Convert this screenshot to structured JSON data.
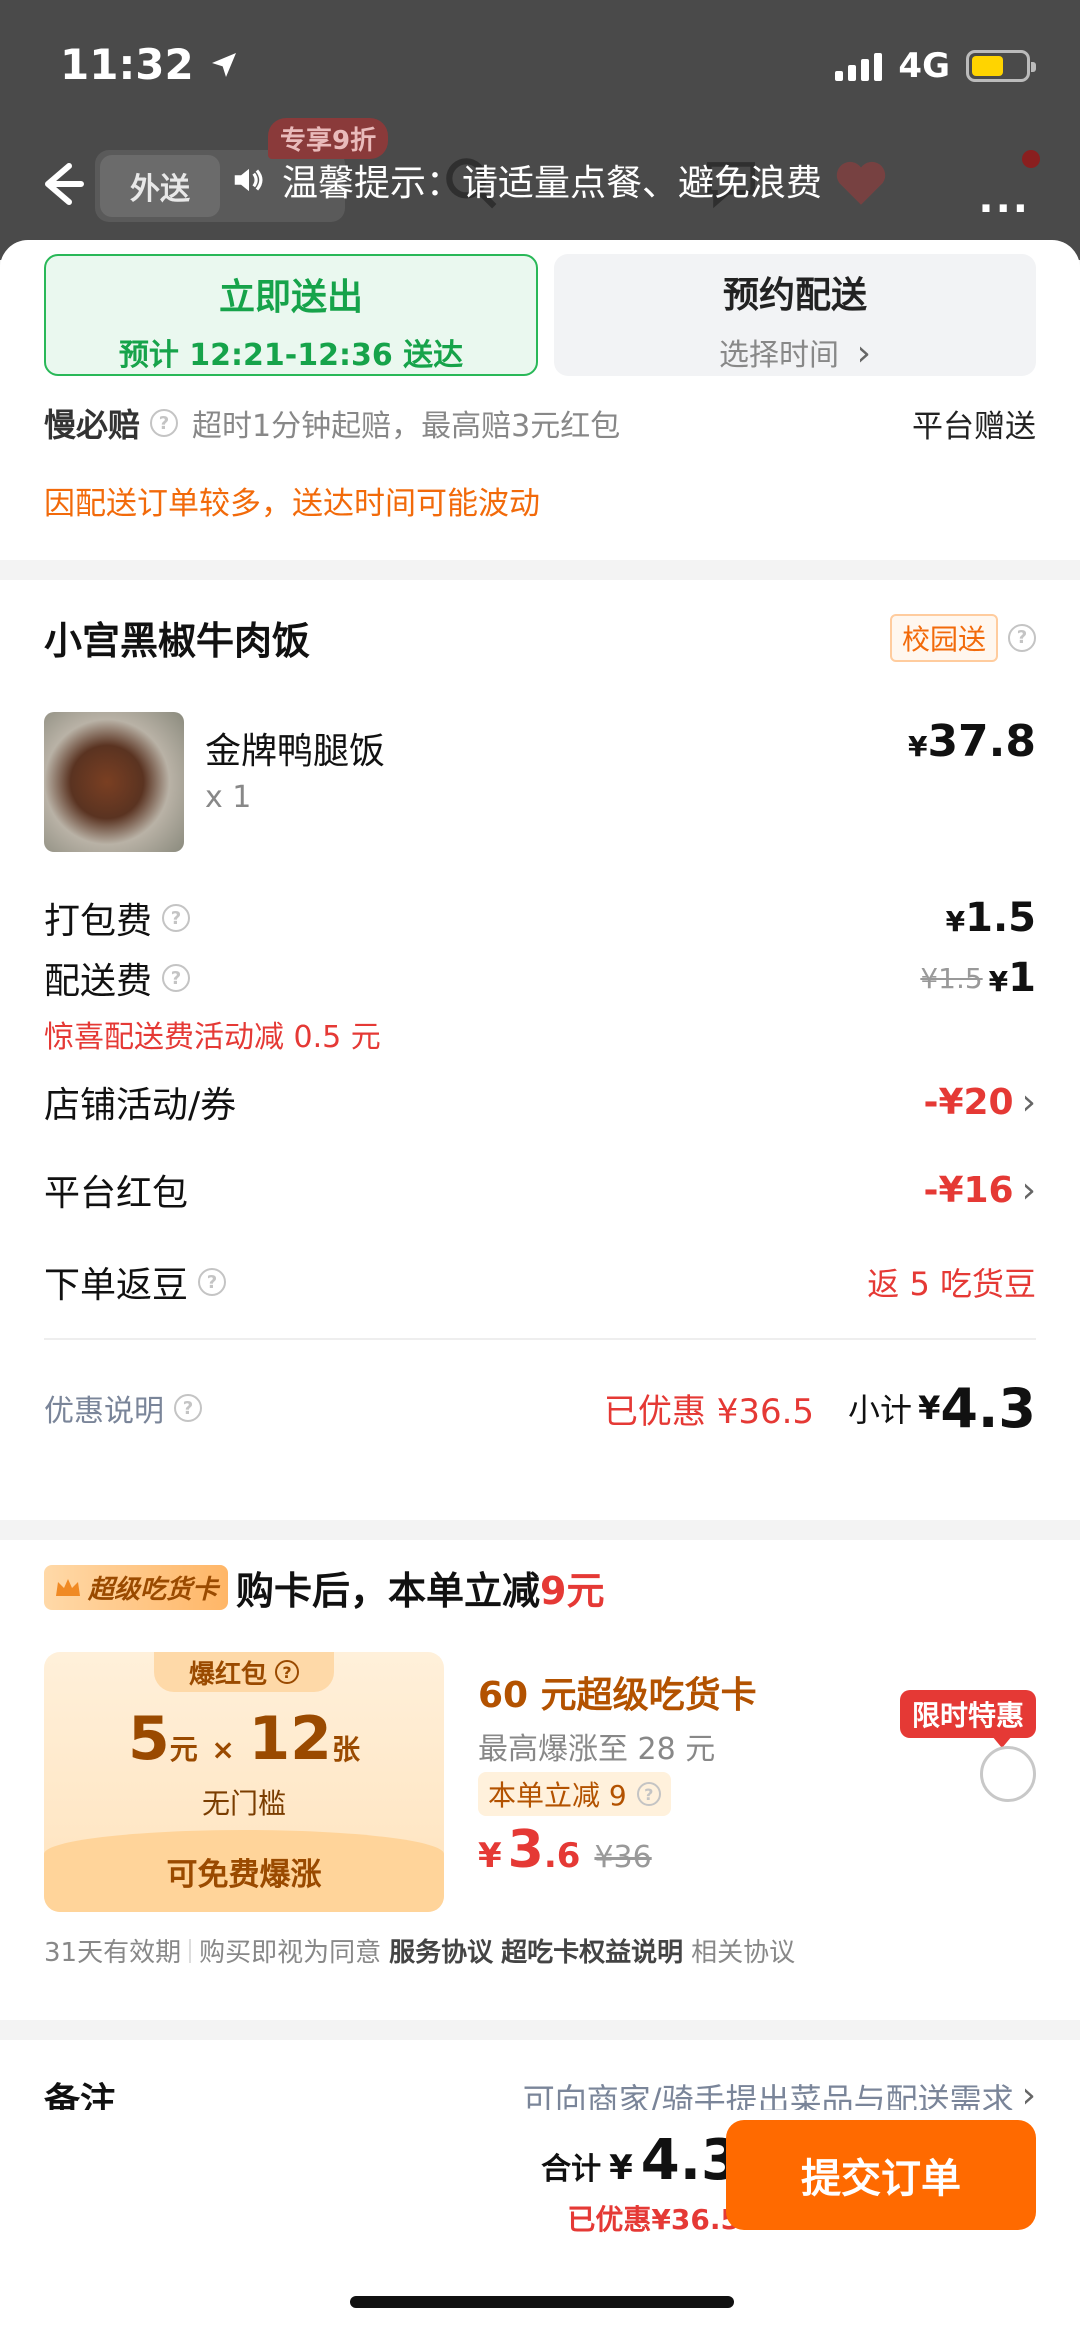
{
  "status_bar": {
    "time": "11:32",
    "network": "4G"
  },
  "nav": {
    "tab_active": "外送",
    "promo_tag": "专享9折",
    "notice": "温馨提示：请适量点餐、避免浪费",
    "more": "..."
  },
  "delivery": {
    "now_title": "立即送出",
    "now_eta": "预计 12:21-12:36 送达",
    "later_title": "预约配送",
    "later_sub": "选择时间",
    "slow_label": "慢必赔",
    "slow_desc": "超时1分钟起赔，最高赔3元红包",
    "slow_right": "平台赠送",
    "warning": "因配送订单较多，送达时间可能波动"
  },
  "order": {
    "shop_name": "小宫黑椒牛肉饭",
    "campus_tag": "校园送",
    "item_name": "金牌鸭腿饭",
    "item_qty": "x 1",
    "item_price": "37.8",
    "yen": "¥",
    "packing_label": "打包费",
    "packing_value": "1.5",
    "delivery_label": "配送费",
    "delivery_orig": "¥1.5",
    "delivery_value": "1",
    "delivery_promo": "惊喜配送费活动减 0.5 元",
    "shop_promo_label": "店铺活动/券",
    "shop_promo_value": "-¥20",
    "platform_label": "平台红包",
    "platform_value": "-¥16",
    "beans_label": "下单返豆",
    "beans_value": "返 5 吃货豆",
    "discount_label": "优惠说明",
    "discount_value": "已优惠 ¥36.5",
    "subtotal_label": "小计",
    "subtotal_value": "4.3"
  },
  "super_card": {
    "badge": "超级吃货卡",
    "headline_prefix": "购卡后，本单立减",
    "headline_amount": "9元",
    "coupon_tab": "爆红包",
    "coupon_num1": "5",
    "coupon_unit1": "元",
    "coupon_times": "×",
    "coupon_num2": "12",
    "coupon_unit2": "张",
    "coupon_sub": "无门槛",
    "coupon_foot": "可免费爆涨",
    "card_title": "60 元超级吃货卡",
    "card_sub": "最高爆涨至 28 元",
    "reduce_tag": "本单立减 9",
    "price_yen": "¥",
    "price_int": "3",
    "price_dec": ".6",
    "price_orig": "¥36",
    "limited": "限时特惠",
    "validity": "31天有效期",
    "terms_prefix": "购买即视为同意",
    "terms_service": "服务协议",
    "terms_rights": "超吃卡权益说明",
    "terms_related": "相关协议"
  },
  "remark": {
    "label": "备注",
    "hint": "可向商家/骑手提出菜品与配送需求"
  },
  "bottom": {
    "total_label": "合计",
    "total_yen": "¥",
    "total_value": "4.3",
    "saved": "已优惠¥36.5",
    "submit": "提交订单"
  },
  "colors": {
    "green": "#16a34a",
    "orange": "#ff6a00",
    "red": "#e53935",
    "gold": "#9a4a00"
  }
}
